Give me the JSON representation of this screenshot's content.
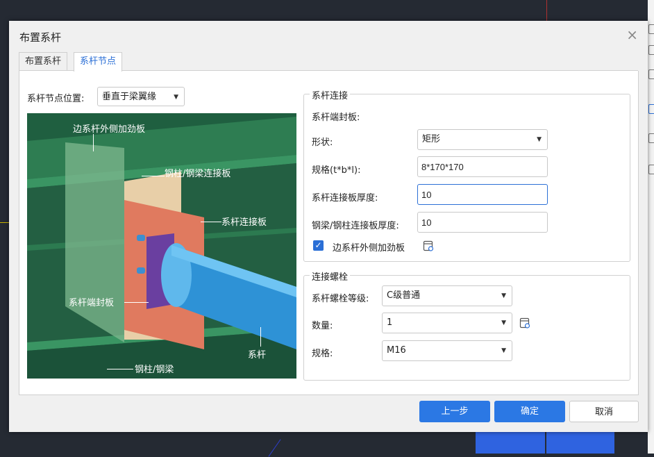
{
  "dialog": {
    "title": "布置系杆",
    "close_glyph": "×"
  },
  "tabs": [
    {
      "label": "布置系杆",
      "active": false
    },
    {
      "label": "系杆节点",
      "active": true
    }
  ],
  "node_position": {
    "label": "系杆节点位置:",
    "value": "垂直于梁翼缘"
  },
  "illustration": {
    "labels": {
      "outer_stiffener": "边系杆外侧加劲板",
      "column_beam_plate": "钢柱/钢梁连接板",
      "tie_plate": "系杆连接板",
      "end_plate": "系杆端封板",
      "tie_rod": "系杆",
      "column_beam": "钢柱/钢梁"
    }
  },
  "tie_connection": {
    "group_title": "系杆连接",
    "end_plate_heading": "系杆端封板:",
    "shape": {
      "label": "形状:",
      "value": "矩形"
    },
    "spec": {
      "label": "规格(t*b*l):",
      "value": "8*170*170"
    },
    "tie_plate_thickness": {
      "label": "系杆连接板厚度:",
      "value": "10"
    },
    "beam_plate_thickness": {
      "label": "钢梁/钢柱连接板厚度:",
      "value": "10"
    },
    "outer_stiffener": {
      "label": "边系杆外侧加劲板",
      "checked": true,
      "icon": "document-settings-icon"
    }
  },
  "bolts": {
    "group_title": "连接螺栓",
    "grade": {
      "label": "系杆螺栓等级:",
      "value": "C级普通"
    },
    "count": {
      "label": "数量:",
      "value": "1",
      "icon": "document-settings-icon"
    },
    "spec": {
      "label": "规格:",
      "value": "M16"
    }
  },
  "buttons": {
    "prev": "上一步",
    "ok": "确定",
    "cancel": "取消"
  },
  "colors": {
    "accent": "#2b78e4",
    "tab_active_text": "#2b6fd6",
    "illustration_bg": "#1f5f40"
  }
}
